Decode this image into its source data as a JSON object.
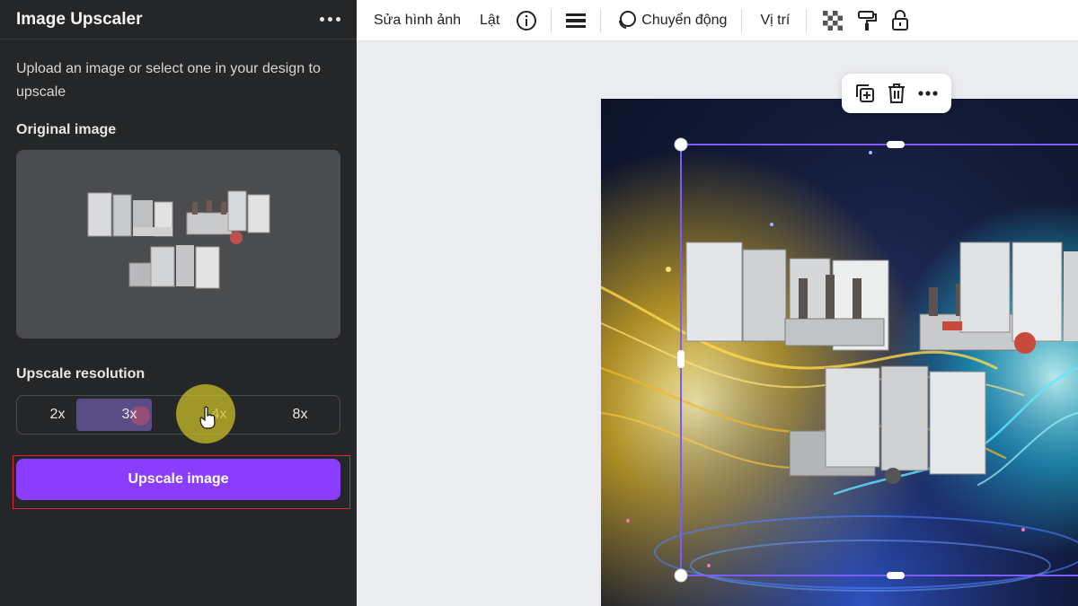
{
  "panel": {
    "title": "Image Upscaler",
    "description": "Upload an image or select one in your design to upscale",
    "original_image_label": "Original image",
    "upscale_resolution_label": "Upscale resolution",
    "resolutions": [
      "2x",
      "3x",
      "4x",
      "8x"
    ],
    "selected_resolution": "3x",
    "upscale_button": "Upscale image"
  },
  "toolbar": {
    "edit_image": "Sửa hình ảnh",
    "flip": "Lật",
    "animate": "Chuyển động",
    "position": "Vị trí"
  },
  "colors": {
    "accent": "#8b3dff",
    "panel_bg": "#252627",
    "selection": "#7d5cff"
  }
}
